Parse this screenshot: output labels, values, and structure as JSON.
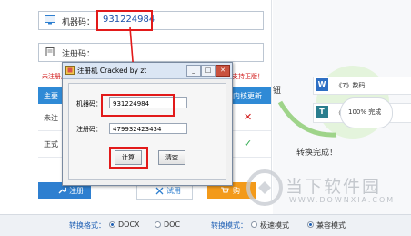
{
  "main": {
    "machine_code_label": "机器码：",
    "machine_code_value": "931224984",
    "register_code_label": "注册码：",
    "warning_text": "未注册用户...",
    "support_text": "支持正版！",
    "table_header": {
      "col1": "主要",
      "col2": "内核更新"
    },
    "rows": [
      {
        "label": "未注",
        "mark": "✕"
      },
      {
        "label": "正式",
        "mark": "✓"
      }
    ],
    "register_button": "注册",
    "trial_button": "试用",
    "buy_button": "购"
  },
  "right": {
    "task1_text": "《7》数码",
    "task2_text": "《7》",
    "progress_text": "100% 完成",
    "button_partial": "钮",
    "convert_done": "转换完成！"
  },
  "watermark": {
    "text": "当下软件园",
    "url": "WWW.DOWNXIA.COM"
  },
  "dialog": {
    "title": "注册机 Cracked by zt",
    "machine_code_label": "机器码：",
    "machine_code_value": "931224984",
    "register_code_label": "注册码：",
    "register_code_value": "479932423434",
    "compute_button": "计算",
    "clear_button": "清空",
    "minimize": "_",
    "maximize": "□",
    "close": "✕"
  },
  "bottom": {
    "format_label": "转换格式：",
    "format_options": [
      "DOCX",
      "DOC"
    ],
    "format_selected": "DOCX",
    "mode_label": "转换模式：",
    "mode_options": [
      "极速模式",
      "兼容模式"
    ],
    "mode_selected": "兼容模式"
  },
  "colors": {
    "accent_blue": "#2e7fd0",
    "highlight_red": "#e21a1a",
    "orange": "#f39a1a"
  }
}
